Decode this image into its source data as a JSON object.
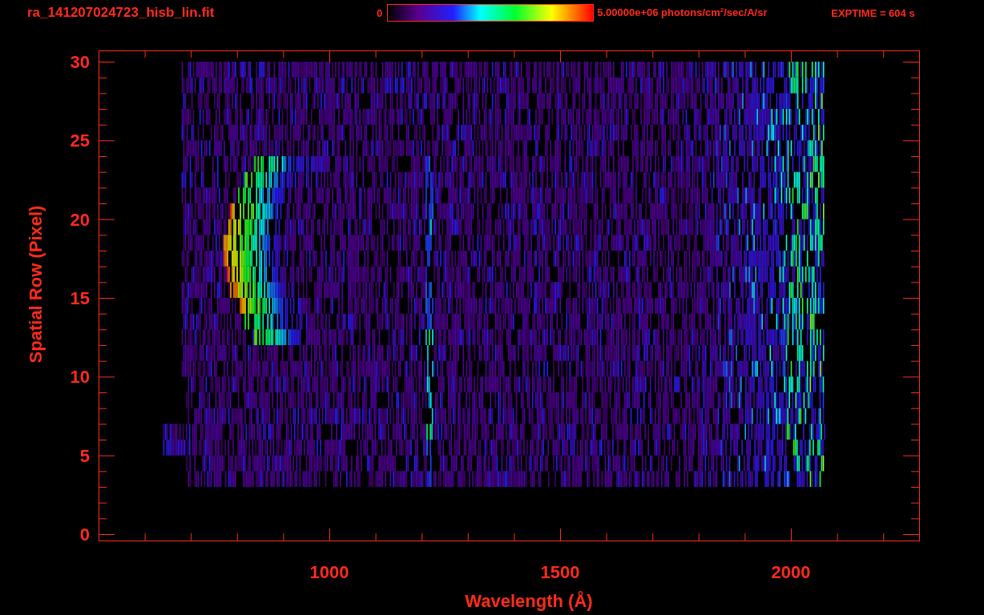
{
  "header": {
    "title": "ra_141207024723_hisb_lin.fit",
    "colorbar_min": "0",
    "colorbar_max": "5.00000e+06 photons/cm$^{2}$/sec/A/sr",
    "exposure": "EXPTIME = 604 s"
  },
  "plot": {
    "xlabel": "Wavelength (Å)",
    "ylabel": "Spatial Row (Pixel)",
    "xticks": [
      "1000",
      "1500",
      "2000"
    ],
    "yticks": [
      "30",
      "25",
      "20",
      "15",
      "10",
      "5",
      "0"
    ]
  }
}
